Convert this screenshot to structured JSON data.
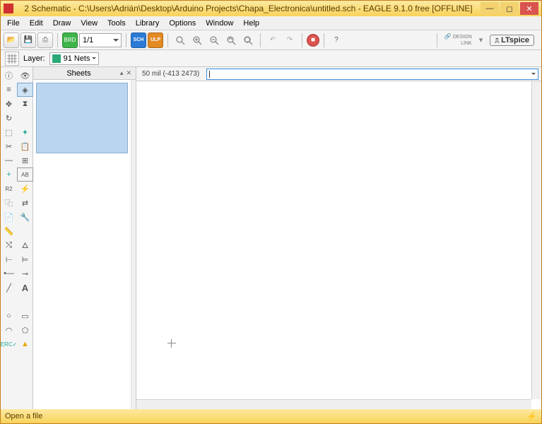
{
  "title": "2 Schematic - C:\\Users\\Adrián\\Desktop\\Arduino Projects\\Chapa_Electronica\\untitled.sch - EAGLE 9.1.0 free [OFFLINE]",
  "menu": [
    "File",
    "Edit",
    "Draw",
    "View",
    "Tools",
    "Library",
    "Options",
    "Window",
    "Help"
  ],
  "sheet_selector": "1/1",
  "layer_label": "Layer:",
  "layer_value": "91 Nets",
  "sheets_header": "Sheets",
  "coord_text": "50 mil (-413 2473)",
  "status_text": "Open a file",
  "brand_design": "DESIGN\nLINK",
  "brand_ltspice": "LTspice",
  "window_buttons": {
    "min": "—",
    "max": "◻",
    "close": "✕"
  },
  "icons": {
    "open": "📂",
    "save": "💾",
    "print": "⎙",
    "brd": "BRD",
    "sch": "SCH",
    "ulp": "ULP",
    "zfit": "⤢",
    "zin": "+",
    "zout": "−",
    "zredraw": "↻",
    "zsel": "⧈",
    "undo": "↶",
    "redo": "↷",
    "stop": "■",
    "help": "?"
  }
}
